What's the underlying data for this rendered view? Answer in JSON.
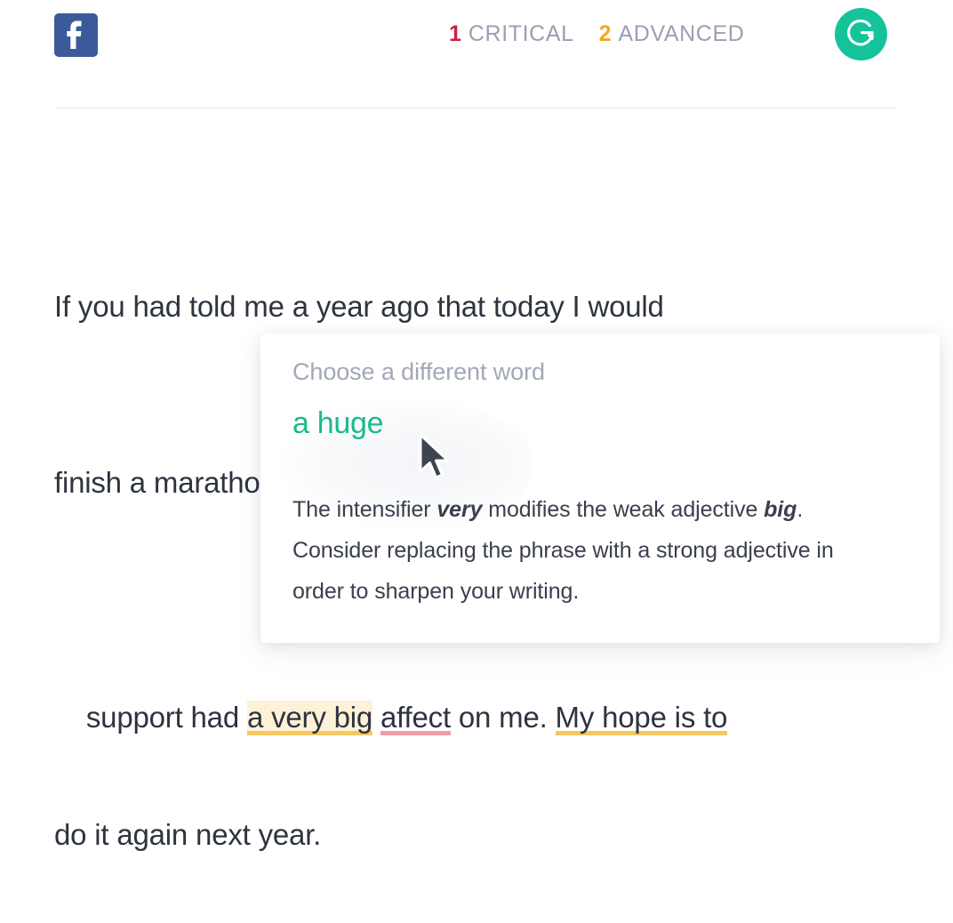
{
  "header": {
    "facebook_icon": "facebook-icon",
    "grammarly_icon": "grammarly-logo-icon",
    "counts": [
      {
        "num": "1",
        "label": "CRITICAL",
        "color": "#cf1f44",
        "kind": "critical"
      },
      {
        "num": "2",
        "label": "ADVANCED",
        "color": "#f5a623",
        "kind": "advanced"
      }
    ]
  },
  "document": {
    "line1": "If you had told me a year ago that today I would",
    "line2": "finish a marathon, I would have laughed. Your",
    "line3_pre": "support had ",
    "line3_highlight": "a very big",
    "line3_mid": " ",
    "line3_error": "affect",
    "line3_post": " on me. ",
    "line3_advanced": "My hope is to",
    "line4": "do it again next year."
  },
  "card": {
    "title": "Choose a different word",
    "suggestion": "a huge",
    "explanation_part1": "The intensifier ",
    "explanation_bold1": "very",
    "explanation_part2": " modifies the weak adjective ",
    "explanation_bold2": "big",
    "explanation_part3": ". Consider replacing the phrase with a strong adjective in order to sharpen your writing."
  },
  "colors": {
    "brand_green": "#15c39a",
    "suggestion_green": "#18bb8a",
    "critical_red": "#cf1f44",
    "advanced_orange": "#f5a623",
    "highlight_bg": "#fdf2d7",
    "underline_yellow": "#f7c85f",
    "underline_pink": "#f39ca9",
    "facebook_blue": "#3c5a99",
    "text_dark": "#2e3340",
    "text_muted": "#a3a8b8"
  }
}
